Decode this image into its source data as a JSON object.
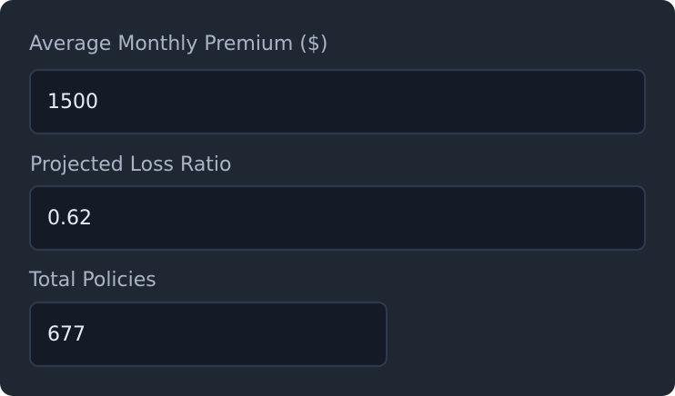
{
  "form": {
    "fields": [
      {
        "label": "Average Monthly Premium ($)",
        "value": "1500"
      },
      {
        "label": "Projected Loss Ratio",
        "value": "0.62"
      },
      {
        "label": "Total Policies",
        "value": "677"
      }
    ]
  },
  "colors": {
    "panel_background": "#1f2733",
    "input_background": "#151b26",
    "input_border": "#2f3b4c",
    "label_text": "#a9b4c6",
    "input_text": "#e8edf5"
  }
}
